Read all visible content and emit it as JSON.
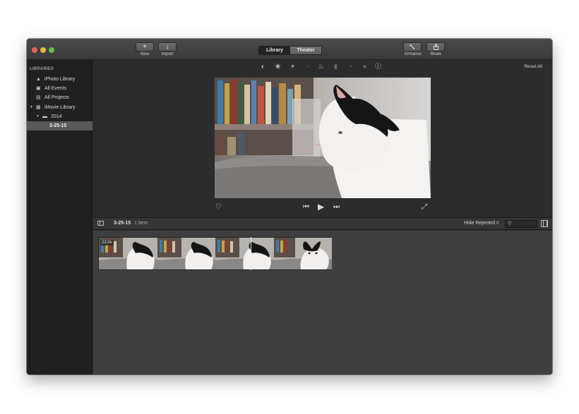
{
  "window": {
    "traffic_lights": [
      "close",
      "minimize",
      "zoom"
    ],
    "accent": "#595959"
  },
  "toolbar": {
    "new_glyph": "+",
    "new_label": "New",
    "import_glyph": "↓",
    "import_label": "Import",
    "tabs": [
      {
        "label": "Library",
        "selected": true
      },
      {
        "label": "Theater",
        "selected": false
      }
    ],
    "enhance_label": "Enhance",
    "share_label": "Share"
  },
  "sidebar": {
    "header": "LIBRARIES",
    "items": [
      {
        "label": "iPhoto Library",
        "icon": "camera-icon"
      },
      {
        "label": "All Events",
        "icon": "star-icon"
      },
      {
        "label": "All Projects",
        "icon": "list-icon"
      },
      {
        "label": "iMovie Library",
        "icon": "grid-icon",
        "expanded": true
      },
      {
        "label": "2014",
        "icon": "folder-icon",
        "expanded": true
      },
      {
        "label": "3-25-15",
        "selected": true
      }
    ]
  },
  "adjust_bar": {
    "icons": [
      "color-balance-icon",
      "color-correction-icon",
      "crop-icon",
      "stabilization-icon",
      "volume-icon",
      "noise-reduction-icon",
      "speed-icon",
      "clip-filter-icon",
      "info-icon"
    ],
    "reset_label": "Reset All"
  },
  "viewer": {
    "favorite_icon": "heart-icon",
    "controls": [
      "skip-back-icon",
      "play-icon",
      "skip-forward-icon"
    ],
    "fullscreen_icon": "fullscreen-icon"
  },
  "browser": {
    "event_title": "3-25-15",
    "item_count": "1 Item",
    "filter_label": "Hide Rejected ◊",
    "search_placeholder": "",
    "clip": {
      "duration": "22.0s",
      "frames": 4
    }
  }
}
